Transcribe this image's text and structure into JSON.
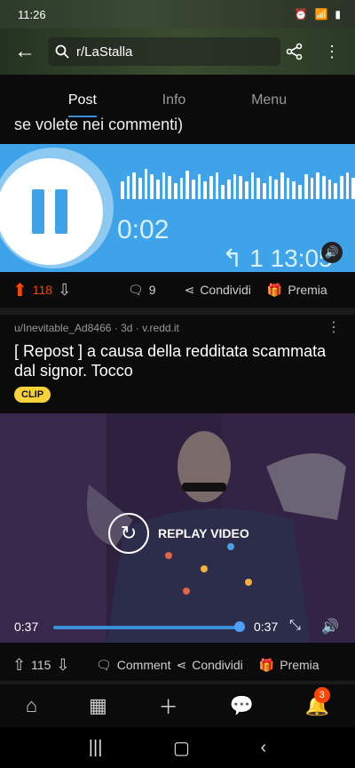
{
  "status": {
    "time": "11:26"
  },
  "header": {
    "search_text": "r/LaStalla"
  },
  "tabs": [
    {
      "label": "Post"
    },
    {
      "label": "Info"
    },
    {
      "label": "Menu"
    }
  ],
  "first_post": {
    "text_tail": "se volete nei commenti)",
    "audio": {
      "time": "0:02",
      "bottom_text": "1 13:05"
    },
    "actions": {
      "votes": "118",
      "comments": "9",
      "share": "Condividi",
      "award": "Premia"
    }
  },
  "second_post": {
    "meta": "u/Inevitable_Ad8466 · 3d · v.redd.it",
    "title": "[ Repost ] a causa della redditata scammata dal signor. Tocco",
    "flair": "CLIP",
    "video": {
      "replay_label": "REPLAY VIDEO",
      "time_current": "0:37",
      "time_total": "0:37",
      "progress": 1.0
    },
    "actions": {
      "votes": "115",
      "comment": "Comment",
      "share": "Condividi",
      "award": "Premia"
    }
  },
  "bottom_nav": {
    "notification_count": "3"
  },
  "colors": {
    "accent": "#3b8fd8",
    "upvote": "#ff4500",
    "audio_bg": "#3fa3ea",
    "flair": "#f7d238"
  }
}
